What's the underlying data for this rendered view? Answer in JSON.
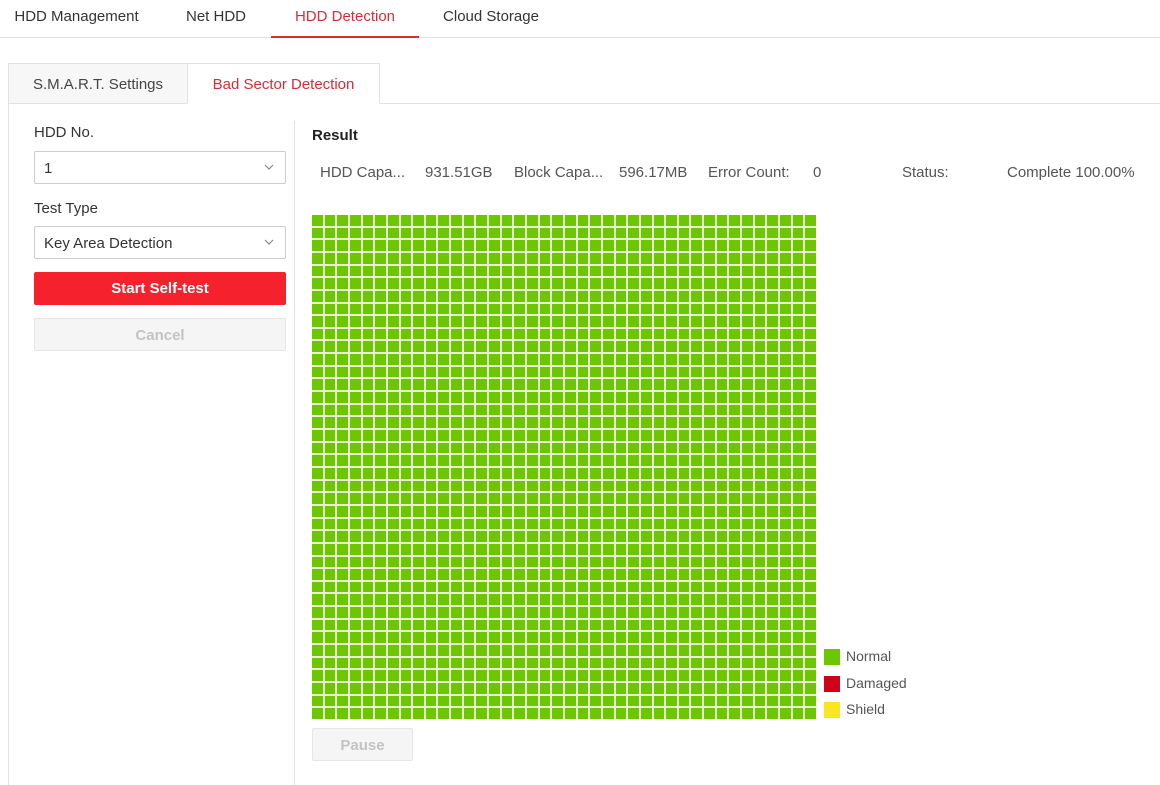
{
  "top_nav": {
    "tabs": [
      {
        "label": "HDD Management",
        "active": false
      },
      {
        "label": "Net HDD",
        "active": false
      },
      {
        "label": "HDD Detection",
        "active": true
      },
      {
        "label": "Cloud Storage",
        "active": false
      }
    ]
  },
  "sub_tabs": [
    {
      "label": "S.M.A.R.T. Settings",
      "active": false
    },
    {
      "label": "Bad Sector Detection",
      "active": true
    }
  ],
  "form": {
    "hdd_no_label": "HDD No.",
    "hdd_no_value": "1",
    "test_type_label": "Test Type",
    "test_type_value": "Key Area Detection",
    "start_button": "Start Self-test",
    "cancel_button": "Cancel"
  },
  "result": {
    "title": "Result",
    "hdd_capacity_label": "HDD Capa...",
    "hdd_capacity_value": "931.51GB",
    "block_capacity_label": "Block Capa...",
    "block_capacity_value": "596.17MB",
    "error_count_label": "Error Count:",
    "error_count_value": "0",
    "status_label": "Status:",
    "status_value": "Complete 100.00%",
    "progress_percent": 100,
    "grid": {
      "columns": 40,
      "rows": 40,
      "block_state": "normal"
    },
    "pause_button": "Pause"
  },
  "legend": [
    {
      "label": "Normal",
      "state": "normal",
      "color": "#6cc700"
    },
    {
      "label": "Damaged",
      "state": "damaged",
      "color": "#d0021b"
    },
    {
      "label": "Shield",
      "state": "shield",
      "color": "#f8e71c"
    }
  ],
  "colors": {
    "accent": "#e02933",
    "primary_button": "#f5222d"
  }
}
